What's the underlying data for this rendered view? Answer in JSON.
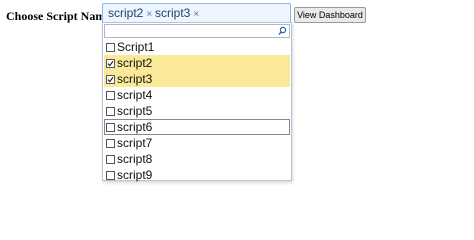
{
  "form": {
    "label": "Choose Script Name :",
    "selected": [
      {
        "text": "script2",
        "remove": "×"
      },
      {
        "text": "script3",
        "remove": "×"
      }
    ],
    "search_value": "",
    "view_button": "View Dashboard"
  },
  "options": [
    {
      "label": "Script1",
      "checked": false,
      "focused": false
    },
    {
      "label": "script2",
      "checked": true,
      "focused": false
    },
    {
      "label": "script3",
      "checked": true,
      "focused": false
    },
    {
      "label": "script4",
      "checked": false,
      "focused": false
    },
    {
      "label": "script5",
      "checked": false,
      "focused": false
    },
    {
      "label": "script6",
      "checked": false,
      "focused": true
    },
    {
      "label": "script7",
      "checked": false,
      "focused": false
    },
    {
      "label": "script8",
      "checked": false,
      "focused": false
    },
    {
      "label": "script9",
      "checked": false,
      "focused": false
    }
  ],
  "icons": {
    "search": "search-icon",
    "check": "checkmark-icon"
  },
  "colors": {
    "selected_row": "#fbe99a",
    "token_text": "#1f3f78",
    "box_border": "#8bb8e8"
  }
}
